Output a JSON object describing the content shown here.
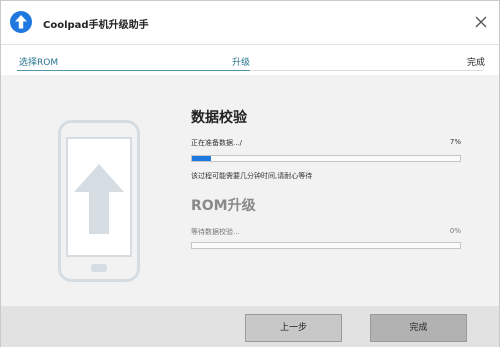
{
  "window": {
    "title": "Coolpad手机升级助手"
  },
  "steps": [
    {
      "label": "选择ROM"
    },
    {
      "label": "升级"
    },
    {
      "label": "完成"
    }
  ],
  "verify": {
    "title": "数据校验",
    "status": "正在准备数据.../",
    "percent": "7%",
    "progress": 0.07,
    "note": "该过程可能需要几分钟时间,请耐心等待"
  },
  "rom": {
    "title": "ROM升级",
    "status": "等待数据校验...",
    "percent": "0%",
    "progress": 0.0
  },
  "footer": {
    "prev_label": "上一步",
    "finish_label": "完成"
  },
  "colors": {
    "accent": "#1f78e0",
    "step_text": "#26728f",
    "phone": "#d5dde3",
    "arrow": "#d5dde3"
  },
  "icons": {
    "app": "upload-arrow-icon",
    "close": "close-icon",
    "phone": "phone-upgrade-illustration"
  }
}
